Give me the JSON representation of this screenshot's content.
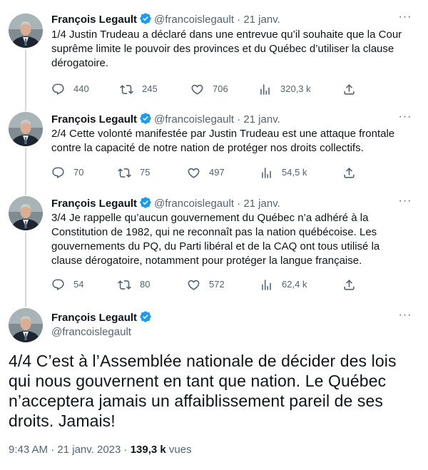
{
  "colors": {
    "accent": "#1d9bf0",
    "text": "#0f1419",
    "muted": "#536471",
    "thread_line": "#cfd9de"
  },
  "author": {
    "name": "François Legault",
    "handle": "@francoislegault",
    "verified_icon": "verified-badge-icon"
  },
  "tweets": [
    {
      "date": "21 janv.",
      "text": "1/4 Justin Trudeau a déclaré dans une entrevue qu’il souhaite que la Cour suprême limite le pouvoir des provinces et du Québec d’utiliser la clause dérogatoire.",
      "replies": "440",
      "retweets": "245",
      "likes": "706",
      "views": "320,3 k"
    },
    {
      "date": "21 janv.",
      "text": "2/4 Cette volonté manifestée par Justin Trudeau est une attaque frontale contre la capacité de notre nation de protéger nos droits collectifs.",
      "replies": "70",
      "retweets": "75",
      "likes": "497",
      "views": "54,5 k"
    },
    {
      "date": "21 janv.",
      "text": "3/4 Je rappelle qu’aucun gouvernement du Québec n’a adhéré à la Constitution de 1982, qui ne reconnaît pas la nation québécoise. Les gouvernements du PQ, du Parti libéral et de la CAQ ont tous utilisé la clause dérogatoire, notamment pour protéger la langue française.",
      "replies": "54",
      "retweets": "80",
      "likes": "572",
      "views": "62,4 k"
    }
  ],
  "main_tweet": {
    "text": "4/4 C’est à l’Assemblée nationale de décider des lois qui nous gouvernent en tant que nation. Le Québec n’acceptera jamais un affaiblissement pareil de ses droits. Jamais!",
    "time": "9:43 AM",
    "date": "21 janv. 2023",
    "views_count": "139,3 k",
    "views_label": "vues"
  },
  "separator": "·",
  "more_glyph": "···"
}
